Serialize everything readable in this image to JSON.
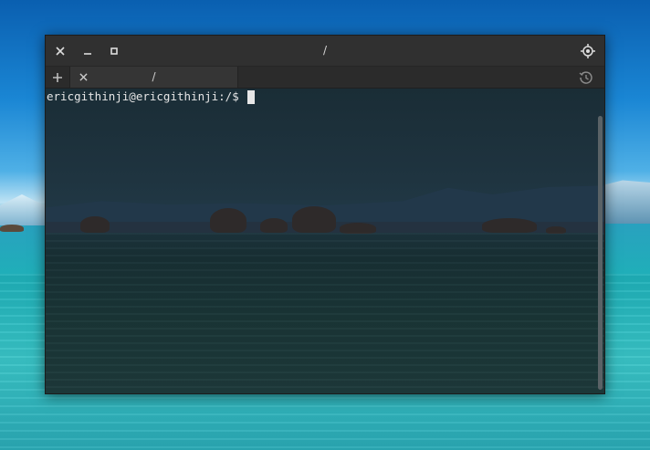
{
  "window": {
    "title": "/",
    "close_icon": "close-icon",
    "minimize_icon": "minimize-icon",
    "maximize_icon": "maximize-icon",
    "menu_icon": "crosshair-menu-icon"
  },
  "tabs": {
    "add_icon": "plus-icon",
    "items": [
      {
        "title": "/",
        "close_icon": "close-icon"
      }
    ],
    "history_icon": "history-icon"
  },
  "terminal": {
    "prompt": "ericgithinji@ericgithinji:/$"
  },
  "colors": {
    "titlebar": "#303030",
    "tabbar": "#2b2b2b",
    "active_tab": "#353535",
    "text": "#e6e6e6"
  }
}
